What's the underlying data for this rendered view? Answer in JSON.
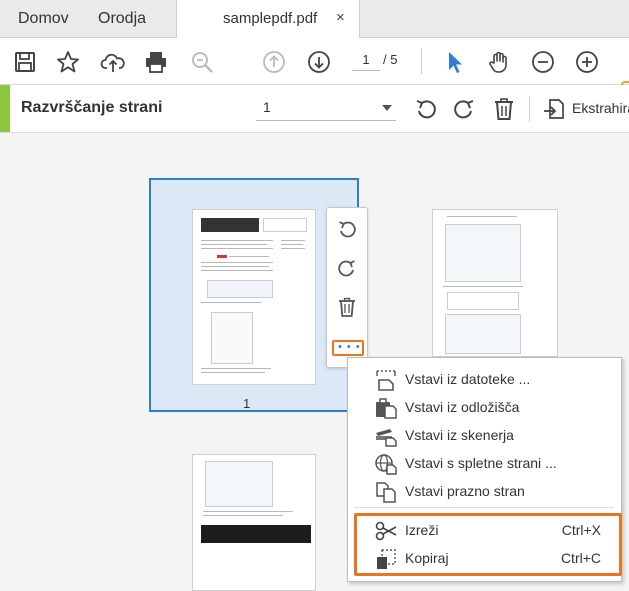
{
  "tabs": {
    "home": "Domov",
    "tools": "Orodja",
    "document": "samplepdf.pdf",
    "close_glyph": "×"
  },
  "toolbar": {
    "current_page": "1",
    "total_pages": "/ 5"
  },
  "organize": {
    "title": "Razvrščanje strani",
    "page_select": "1",
    "extract_label": "Ekstrahira"
  },
  "thumbnails": {
    "selected_page_number": "1"
  },
  "more_button": {
    "label": "• • •"
  },
  "context_menu": {
    "items": [
      {
        "label": "Vstavi iz datoteke ...",
        "shortcut": "",
        "icon": "insert-file-icon"
      },
      {
        "label": "Vstavi iz odložišča",
        "shortcut": "",
        "icon": "clipboard-icon"
      },
      {
        "label": "Vstavi iz skenerja",
        "shortcut": "",
        "icon": "scanner-icon"
      },
      {
        "label": "Vstavi s spletne strani ...",
        "shortcut": "",
        "icon": "web-page-icon"
      },
      {
        "label": "Vstavi prazno stran",
        "shortcut": "",
        "icon": "blank-page-icon"
      },
      {
        "label": "Izreži",
        "shortcut": "Ctrl+X",
        "icon": "scissors-icon"
      },
      {
        "label": "Kopiraj",
        "shortcut": "Ctrl+C",
        "icon": "copy-icon"
      }
    ]
  },
  "colors": {
    "accent_green": "#8dc63f",
    "selection_blue": "#2d7fd3",
    "highlight_orange": "#e8761f"
  }
}
